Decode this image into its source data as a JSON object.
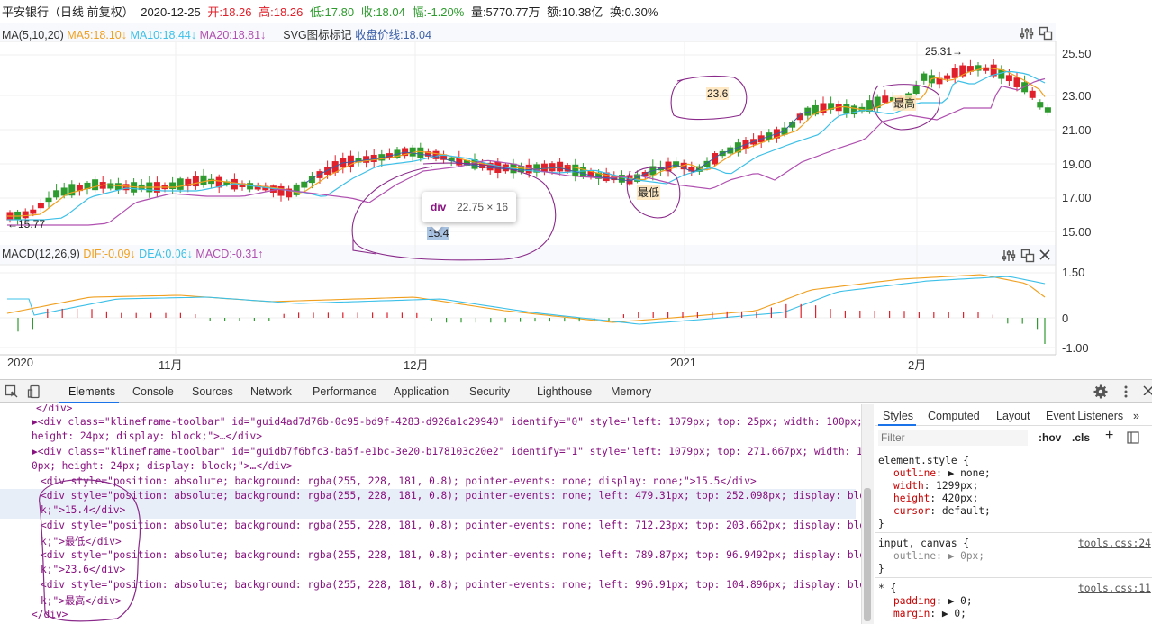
{
  "header": {
    "name": "平安银行（日线 前复权）",
    "date": "2020-12-25",
    "open": "开:18.26",
    "high": "高:18.26",
    "low": "低:17.80",
    "close": "收:18.04",
    "change": "幅:-1.20%",
    "volume": "量:5770.77万",
    "amount": "额:10.38亿",
    "turnover": "换:0.30%"
  },
  "ma_legend": {
    "label": "MA(5,10,20)",
    "ma5": "MA5:18.10↓",
    "ma10": "MA10:18.44↓",
    "ma20": "MA20:18.81↓",
    "svg_label": "SVG图标标记",
    "close_line": "收盘价线:18.04"
  },
  "macd_legend": {
    "label": "MACD(12,26,9)",
    "dif": "DIF:-0.09↓",
    "dea": "DEA:0.06↓",
    "macd": "MACD:-0.31↑"
  },
  "colors": {
    "up": "#e0202a",
    "down": "#2e9b2e",
    "ma5": "#f0a020",
    "ma10": "#3cc0e8",
    "ma20": "#b050b0",
    "close_line": "#3a5fa8",
    "annotation_ink": "#8a2a8a"
  },
  "price_axis": [
    "25.50",
    "23.00",
    "21.00",
    "19.00",
    "17.00",
    "15.00"
  ],
  "macd_axis": [
    "1.50",
    "0",
    "-1.00"
  ],
  "x_axis": [
    "2020",
    "11月",
    "12月",
    "2021",
    "2月"
  ],
  "annotations": {
    "max_price": "25.31→",
    "min_price": "←15.77",
    "label_15_4": "15.4",
    "label_min": "最低",
    "label_23_6": "23.6",
    "label_max": "最高"
  },
  "tooltip": {
    "tag": "div",
    "size": "22.75 × 16"
  },
  "devtools": {
    "tabs": [
      "Elements",
      "Console",
      "Sources",
      "Network",
      "Performance",
      "Application",
      "Security",
      "Lighthouse",
      "Memory"
    ],
    "code_lines": [
      "</div>",
      "▶<div class=\"klineframe-toolbar\" id=\"guid4ad7d76b-0c95-bd9f-4283-d926a1c29940\" identify=\"0\" style=\"left: 1079px; top: 25px; width: 100px;",
      "height: 24px; display: block;\">…</div>",
      "▶<div class=\"klineframe-toolbar\" id=\"guidb7f6bfc3-ba5f-e1bc-3e20-b178103c20e2\" identify=\"1\" style=\"left: 1079px; top: 271.667px; width: 10",
      "0px; height: 24px; display: block;\">…</div>",
      "<div style=\"position: absolute; background: rgba(255, 228, 181, 0.8); pointer-events: none; display: none;\">15.5</div>",
      "<div style=\"position: absolute; background: rgba(255, 228, 181, 0.8); pointer-events: none; left: 479.31px; top: 252.098px; display: bloc",
      "k;\">15.4</div>",
      "<div style=\"position: absolute; background: rgba(255, 228, 181, 0.8); pointer-events: none; left: 712.23px; top: 203.662px; display: bloc",
      "k;\">最低</div>",
      "<div style=\"position: absolute; background: rgba(255, 228, 181, 0.8); pointer-events: none; left: 789.87px; top: 96.9492px; display: bloc",
      "k;\">23.6</div>",
      "<div style=\"position: absolute; background: rgba(255, 228, 181, 0.8); pointer-events: none; left: 996.91px; top: 104.896px; display: bloc",
      "k;\">最高</div>",
      "</div>"
    ],
    "styles_tabs": [
      "Styles",
      "Computed",
      "Layout",
      "Event Listeners",
      "»"
    ],
    "filter_placeholder": "Filter",
    "hov": ":hov",
    "cls": ".cls",
    "element_style_selector": "element.style {",
    "element_style_props": [
      {
        "prop": "outline",
        "val": "▶ none;"
      },
      {
        "prop": "width",
        "val": "1299px;"
      },
      {
        "prop": "height",
        "val": "420px;"
      },
      {
        "prop": "cursor",
        "val": "default;"
      }
    ],
    "rule2_selector": "input, canvas {",
    "rule2_source": "tools.css:24",
    "rule2_prop": "outline: ▶ 0px;",
    "rule3_selector": "* {",
    "rule3_source": "tools.css:11",
    "rule3_props": [
      {
        "prop": "padding",
        "val": "▶ 0;"
      },
      {
        "prop": "margin",
        "val": "▶ 0;"
      }
    ],
    "close_brace": "}"
  }
}
